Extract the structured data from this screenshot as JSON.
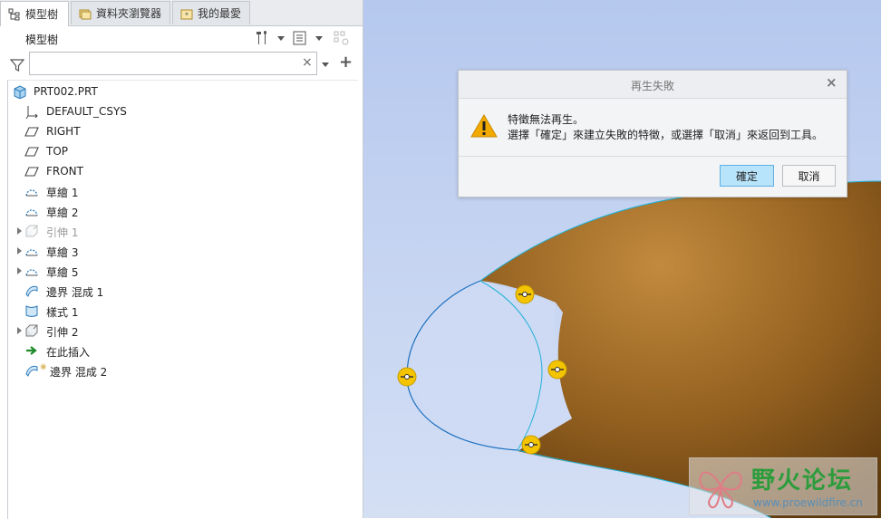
{
  "tabs": [
    {
      "label": "模型樹",
      "icon": "tree-icon",
      "active": true
    },
    {
      "label": "資料夾瀏覽器",
      "icon": "folder-icon",
      "active": false
    },
    {
      "label": "我的最愛",
      "icon": "favorites-icon",
      "active": false
    }
  ],
  "toolbar": {
    "title": "模型樹",
    "settings_icon": "tools-icon",
    "show_icon": "list-icon",
    "filter_disabled_icon": "tree-filter-icon"
  },
  "search": {
    "value": "",
    "placeholder": "",
    "clear_glyph": "×",
    "add_glyph": "+"
  },
  "tree": [
    {
      "label": "PRT002.PRT",
      "icon": "part-icon",
      "indent": 0,
      "expandable": false,
      "dim": false
    },
    {
      "label": "DEFAULT_CSYS",
      "icon": "csys-icon",
      "indent": 1,
      "expandable": false,
      "dim": false
    },
    {
      "label": "RIGHT",
      "icon": "datum-plane-icon",
      "indent": 1,
      "expandable": false,
      "dim": false
    },
    {
      "label": "TOP",
      "icon": "datum-plane-icon",
      "indent": 1,
      "expandable": false,
      "dim": false
    },
    {
      "label": "FRONT",
      "icon": "datum-plane-icon",
      "indent": 1,
      "expandable": false,
      "dim": false
    },
    {
      "label": "草繪 1",
      "icon": "sketch-icon",
      "indent": 1,
      "expandable": false,
      "dim": false
    },
    {
      "label": "草繪 2",
      "icon": "sketch-icon",
      "indent": 1,
      "expandable": false,
      "dim": false
    },
    {
      "label": "引伸 1",
      "icon": "extrude-icon",
      "indent": 1,
      "expandable": true,
      "dim": true
    },
    {
      "label": "草繪 3",
      "icon": "sketch-icon",
      "indent": 1,
      "expandable": true,
      "dim": false
    },
    {
      "label": "草繪 5",
      "icon": "sketch-icon",
      "indent": 1,
      "expandable": true,
      "dim": false
    },
    {
      "label": "邊界 混成 1",
      "icon": "boundary-blend-icon",
      "indent": 1,
      "expandable": false,
      "dim": false
    },
    {
      "label": "樣式 1",
      "icon": "style-icon",
      "indent": 1,
      "expandable": false,
      "dim": false
    },
    {
      "label": "引伸 2",
      "icon": "extrude-icon",
      "indent": 1,
      "expandable": true,
      "dim": false
    },
    {
      "label": "在此插入",
      "icon": "insert-here-icon",
      "indent": 1,
      "expandable": false,
      "dim": false
    },
    {
      "label": "邊界 混成 2",
      "icon": "boundary-blend-failed-icon",
      "indent": 1,
      "expandable": false,
      "dim": false
    }
  ],
  "dialog": {
    "title": "再生失敗",
    "close_glyph": "×",
    "message_line1": "特徵無法再生。",
    "message_line2": "選擇「確定」來建立失敗的特徵，或選擇「取消」來返回到工具。",
    "ok_label": "確定",
    "cancel_label": "取消",
    "icon": "warning-icon"
  },
  "watermark": {
    "title": "野火论坛",
    "url": "www.proewildfire.cn"
  },
  "colors": {
    "surface": "#8f5a1e",
    "surface_highlight": "#c28a3e",
    "curve": "#1a6fc0",
    "handle": "#f5c400",
    "ok_button": "#b8e4fb",
    "watermark_text": "#2c9c3c"
  }
}
